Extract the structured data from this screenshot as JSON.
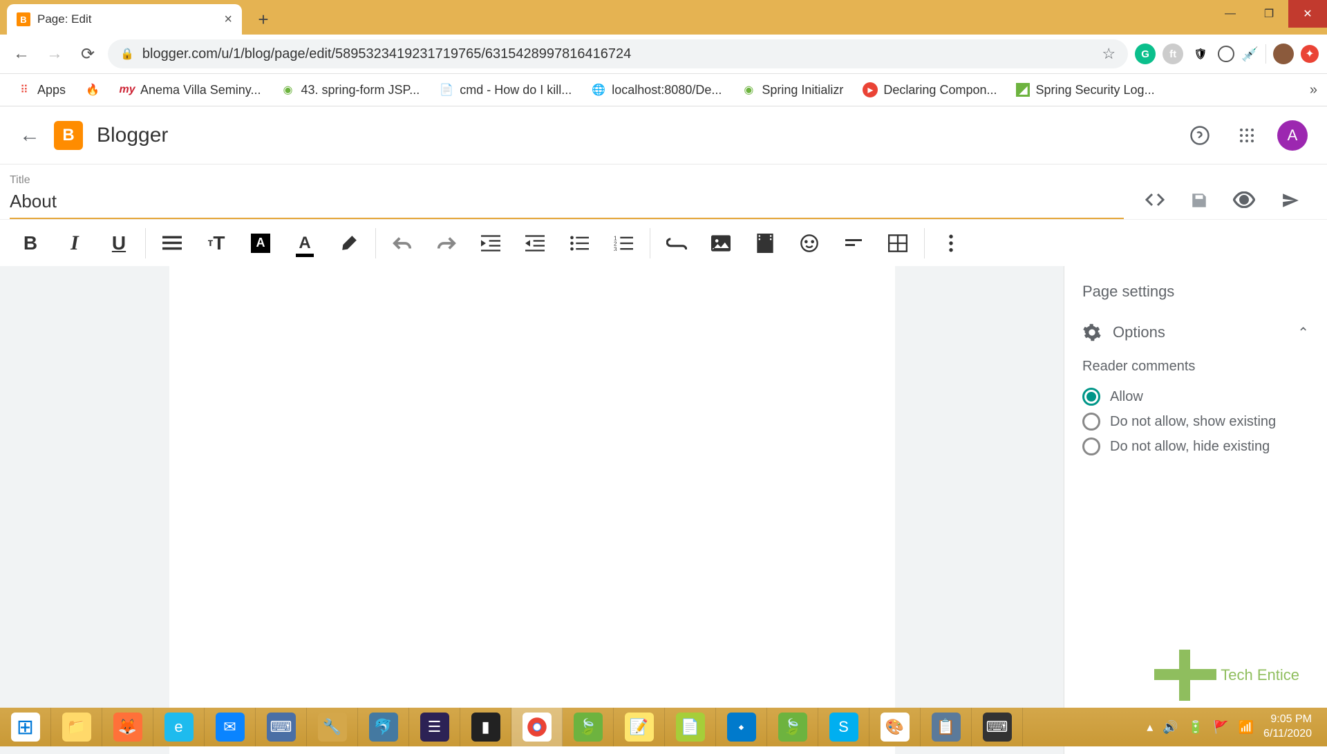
{
  "browser": {
    "tab_title": "Page: Edit",
    "url": "blogger.com/u/1/blog/page/edit/5895323419231719765/6315428997816416724",
    "bookmarks": [
      {
        "label": "Apps"
      },
      {
        "label": ""
      },
      {
        "label": "Anema Villa Seminy..."
      },
      {
        "label": "43. spring-form JSP..."
      },
      {
        "label": "cmd - How do I kill..."
      },
      {
        "label": "localhost:8080/De..."
      },
      {
        "label": "Spring Initializr"
      },
      {
        "label": "Declaring Compon..."
      },
      {
        "label": "Spring Security Log..."
      }
    ]
  },
  "app": {
    "name": "Blogger",
    "avatar_initial": "A"
  },
  "editor": {
    "title_label": "Title",
    "title_value": "About"
  },
  "side_panel": {
    "heading": "Page settings",
    "section_label": "Options",
    "subsection": "Reader comments",
    "radios": [
      {
        "label": "Allow",
        "checked": true
      },
      {
        "label": "Do not allow, show existing",
        "checked": false
      },
      {
        "label": "Do not allow, hide existing",
        "checked": false
      }
    ]
  },
  "watermark": "Tech Entice",
  "taskbar": {
    "time": "9:05 PM",
    "date": "6/11/2020"
  }
}
